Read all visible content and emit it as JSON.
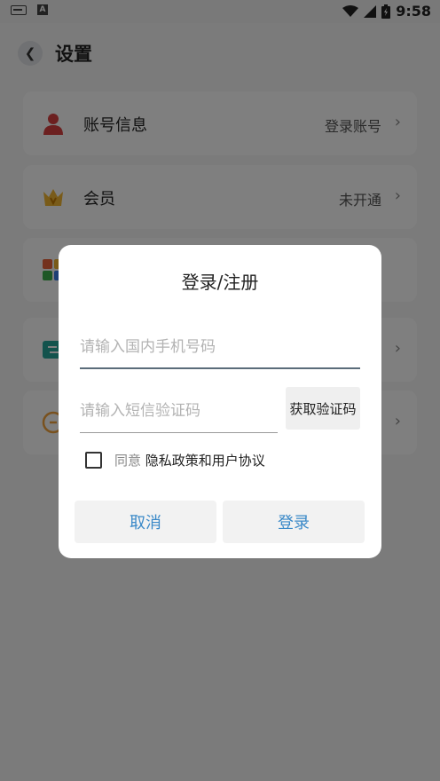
{
  "status_bar": {
    "time": "9:58",
    "icons": [
      "keyboard-icon",
      "a-notification-icon",
      "wifi-icon",
      "signal-icon",
      "battery-icon"
    ]
  },
  "header": {
    "title": "设置"
  },
  "settings_items": [
    {
      "label": "账号信息",
      "value": "登录账号",
      "icon": "user-icon",
      "icon_color": "#d94040"
    },
    {
      "label": "会员",
      "value": "未开通",
      "icon": "crown-icon",
      "icon_color": "#f2b632"
    },
    {
      "label": "",
      "value": "",
      "icon": "apps-icon"
    },
    {
      "label": "",
      "value": "",
      "icon": "teal-icon",
      "icon_color": "#26a69a"
    },
    {
      "label": "",
      "value": "",
      "icon": "circle-icon",
      "icon_color": "#f2a23c"
    }
  ],
  "dialog": {
    "title": "登录/注册",
    "phone_placeholder": "请输入国内手机号码",
    "phone_value": "",
    "code_placeholder": "请输入短信验证码",
    "code_value": "",
    "get_code_label": "获取验证码",
    "agree_prefix": "同意",
    "agree_link": "隐私政策和用户协议",
    "cancel_label": "取消",
    "login_label": "登录",
    "accent_color": "#3a89c8"
  }
}
